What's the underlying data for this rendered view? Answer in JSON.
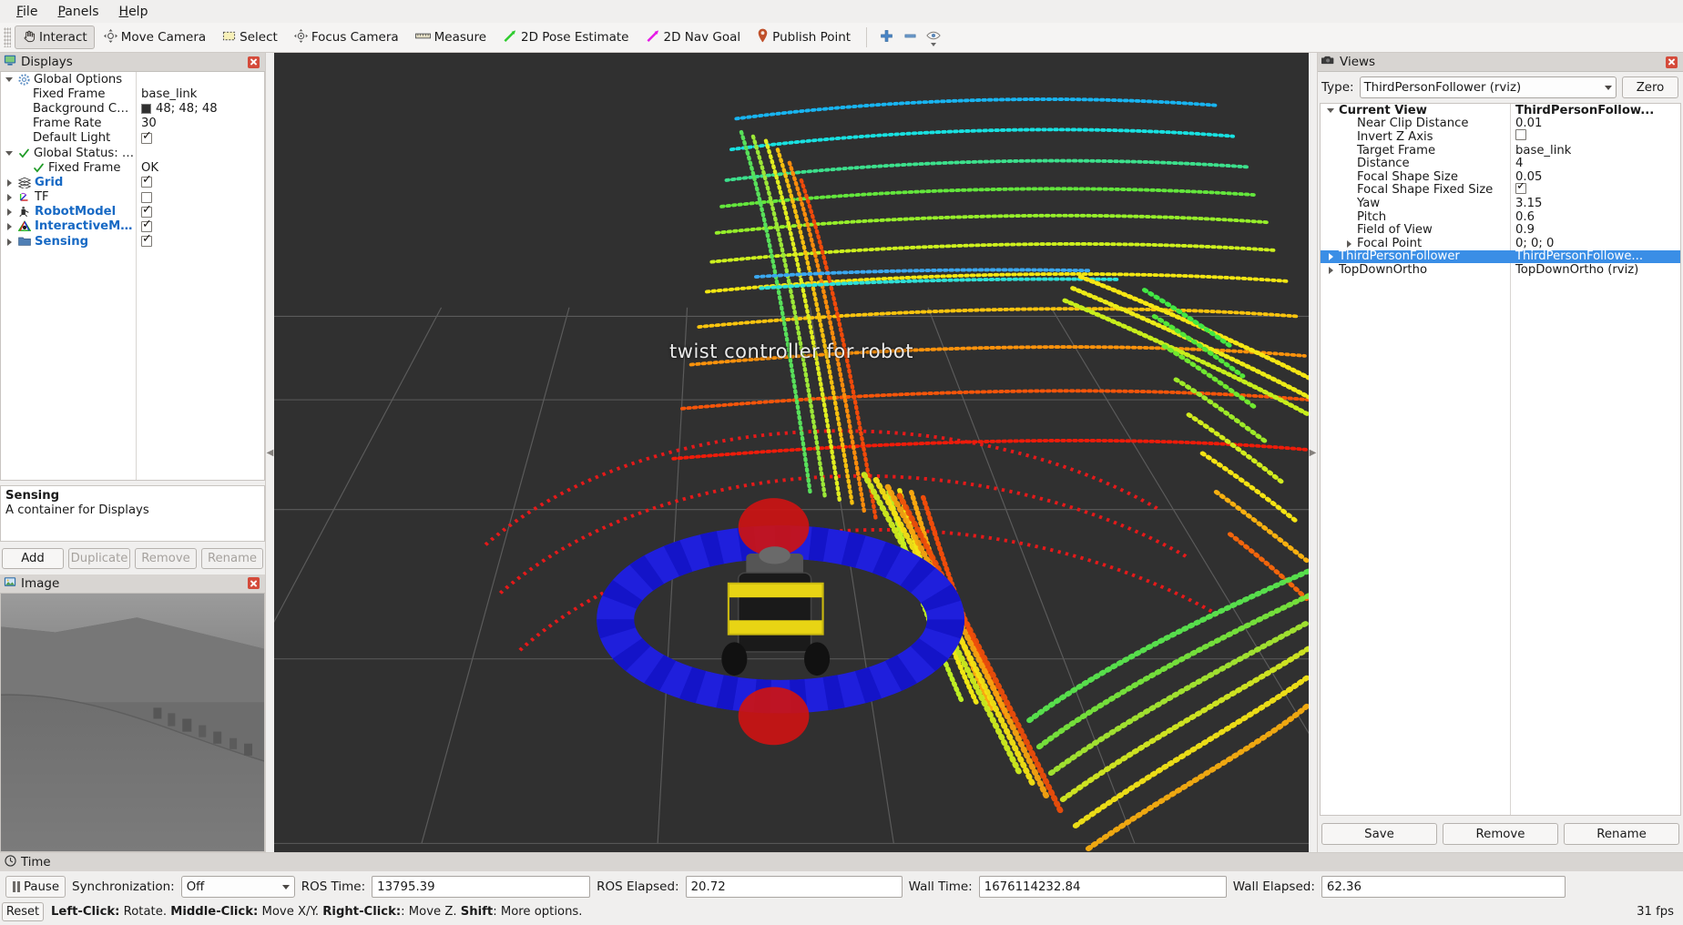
{
  "menu": {
    "items": [
      {
        "name": "file",
        "label": "File",
        "mnemonic": "F"
      },
      {
        "name": "panels",
        "label": "Panels",
        "mnemonic": "P"
      },
      {
        "name": "help",
        "label": "Help",
        "mnemonic": "H"
      }
    ]
  },
  "toolbar": {
    "tools": [
      {
        "name": "interact",
        "label": "Interact",
        "icon": "hand-icon",
        "checked": true
      },
      {
        "name": "move-camera",
        "label": "Move Camera",
        "icon": "move-camera-icon",
        "checked": false
      },
      {
        "name": "select",
        "label": "Select",
        "icon": "select-rect-icon",
        "checked": false
      },
      {
        "name": "focus-camera",
        "label": "Focus Camera",
        "icon": "focus-camera-icon",
        "checked": false
      },
      {
        "name": "measure",
        "label": "Measure",
        "icon": "ruler-icon",
        "checked": false
      },
      {
        "name": "2d-pose-estimate",
        "label": "2D Pose Estimate",
        "icon": "green-arrow-icon",
        "checked": false
      },
      {
        "name": "2d-nav-goal",
        "label": "2D Nav Goal",
        "icon": "magenta-arrow-icon",
        "checked": false
      },
      {
        "name": "publish-point",
        "label": "Publish Point",
        "icon": "map-pin-icon",
        "checked": false
      }
    ],
    "actions": [
      {
        "name": "add-tool",
        "icon": "plus-icon"
      },
      {
        "name": "remove-tool",
        "icon": "minus-icon"
      },
      {
        "name": "tool-properties",
        "icon": "eye-icon"
      }
    ]
  },
  "displays": {
    "title": "Displays",
    "title_icon": "display-monitor-icon",
    "rows": [
      {
        "name": "global-options",
        "indent": 0,
        "arrow": "down",
        "icon": "gear-icon",
        "label": "Global Options",
        "value": "",
        "value_type": "none",
        "bold": false
      },
      {
        "name": "fixed-frame",
        "indent": 1,
        "arrow": "none",
        "icon": "",
        "label": "Fixed Frame",
        "value": "base_link",
        "value_type": "text"
      },
      {
        "name": "background-color",
        "indent": 1,
        "arrow": "none",
        "icon": "",
        "label": "Background Color",
        "value": "48; 48; 48",
        "value_type": "color",
        "color": "#303030"
      },
      {
        "name": "frame-rate",
        "indent": 1,
        "arrow": "none",
        "icon": "",
        "label": "Frame Rate",
        "value": "30",
        "value_type": "text"
      },
      {
        "name": "default-light",
        "indent": 1,
        "arrow": "none",
        "icon": "",
        "label": "Default Light",
        "value": "",
        "value_type": "checkbox",
        "checked": true
      },
      {
        "name": "global-status",
        "indent": 0,
        "arrow": "down",
        "icon": "check-icon",
        "label": "Global Status: Ok",
        "value": "",
        "value_type": "none"
      },
      {
        "name": "status-fixed-frame",
        "indent": 1,
        "arrow": "none",
        "icon": "check-icon",
        "label": "Fixed Frame",
        "value": "OK",
        "value_type": "text"
      },
      {
        "name": "grid",
        "indent": 0,
        "arrow": "right",
        "icon": "grid-icon",
        "label": "Grid",
        "value": "",
        "value_type": "checkbox",
        "checked": true,
        "blue": true
      },
      {
        "name": "tf",
        "indent": 0,
        "arrow": "right",
        "icon": "axes-icon",
        "label": "TF",
        "value": "",
        "value_type": "checkbox",
        "checked": false,
        "blue": false
      },
      {
        "name": "robotmodel",
        "indent": 0,
        "arrow": "right",
        "icon": "robot-icon",
        "label": "RobotModel",
        "value": "",
        "value_type": "checkbox",
        "checked": true,
        "blue": true
      },
      {
        "name": "interactivemarkers",
        "indent": 0,
        "arrow": "right",
        "icon": "interactive-marker-icon",
        "label": "InteractiveMar...",
        "value": "",
        "value_type": "checkbox",
        "checked": true,
        "blue": true
      },
      {
        "name": "sensing",
        "indent": 0,
        "arrow": "right",
        "icon": "folder-icon",
        "label": "Sensing",
        "value": "",
        "value_type": "checkbox",
        "checked": true,
        "blue": true
      }
    ],
    "description": {
      "title": "Sensing",
      "text": "A container for Displays"
    },
    "buttons": [
      {
        "name": "add-display-button",
        "label": "Add",
        "enabled": true
      },
      {
        "name": "duplicate-display-button",
        "label": "Duplicate",
        "enabled": false
      },
      {
        "name": "remove-display-button",
        "label": "Remove",
        "enabled": false
      },
      {
        "name": "rename-display-button",
        "label": "Rename",
        "enabled": false
      }
    ]
  },
  "image_panel": {
    "title": "Image",
    "title_icon": "image-icon"
  },
  "viewport": {
    "overlay_text": "twist  controller  for  robot",
    "background_color": "#303030"
  },
  "views": {
    "title": "Views",
    "title_icon": "camera-icon",
    "type_label": "Type:",
    "type_value": "ThirdPersonFollower (rviz)",
    "zero_button": "Zero",
    "rows": [
      {
        "name": "current-view",
        "indent": 0,
        "arrow": "down",
        "label": "Current View",
        "value": "ThirdPersonFollow...",
        "bold": true,
        "selected": false,
        "value_type": "text"
      },
      {
        "name": "near-clip-distance",
        "indent": 1,
        "arrow": "none",
        "label": "Near Clip Distance",
        "value": "0.01",
        "value_type": "text"
      },
      {
        "name": "invert-z-axis",
        "indent": 1,
        "arrow": "none",
        "label": "Invert Z Axis",
        "value": "",
        "value_type": "checkbox",
        "checked": false
      },
      {
        "name": "target-frame",
        "indent": 1,
        "arrow": "none",
        "label": "Target Frame",
        "value": "base_link",
        "value_type": "text"
      },
      {
        "name": "distance",
        "indent": 1,
        "arrow": "none",
        "label": "Distance",
        "value": "4",
        "value_type": "text"
      },
      {
        "name": "focal-shape-size",
        "indent": 1,
        "arrow": "none",
        "label": "Focal Shape Size",
        "value": "0.05",
        "value_type": "text"
      },
      {
        "name": "focal-shape-fixed-size",
        "indent": 1,
        "arrow": "none",
        "label": "Focal Shape Fixed Size",
        "value": "",
        "value_type": "checkbox",
        "checked": true
      },
      {
        "name": "yaw",
        "indent": 1,
        "arrow": "none",
        "label": "Yaw",
        "value": "3.15",
        "value_type": "text"
      },
      {
        "name": "pitch",
        "indent": 1,
        "arrow": "none",
        "label": "Pitch",
        "value": "0.6",
        "value_type": "text"
      },
      {
        "name": "field-of-view",
        "indent": 1,
        "arrow": "none",
        "label": "Field of View",
        "value": "0.9",
        "value_type": "text"
      },
      {
        "name": "focal-point",
        "indent": 1,
        "arrow": "right",
        "label": "Focal Point",
        "value": "0; 0; 0",
        "value_type": "text"
      },
      {
        "name": "thirdpersonfollower",
        "indent": 0,
        "arrow": "right",
        "label": "ThirdPersonFollower",
        "value": "ThirdPersonFollowe...",
        "value_type": "text",
        "selected": true
      },
      {
        "name": "topdownortho",
        "indent": 0,
        "arrow": "right",
        "label": "TopDownOrtho",
        "value": "TopDownOrtho (rviz)",
        "value_type": "text"
      }
    ],
    "buttons": [
      {
        "name": "save-view-button",
        "label": "Save"
      },
      {
        "name": "remove-view-button",
        "label": "Remove"
      },
      {
        "name": "rename-view-button",
        "label": "Rename"
      }
    ]
  },
  "time": {
    "title": "Time",
    "title_icon": "clock-icon",
    "pause_label": "Pause",
    "sync_label": "Synchronization:",
    "sync_value": "Off",
    "fields": [
      {
        "name": "ros-time",
        "label": "ROS Time:",
        "value": "13795.39"
      },
      {
        "name": "ros-elapsed",
        "label": "ROS Elapsed:",
        "value": "20.72"
      },
      {
        "name": "wall-time",
        "label": "Wall Time:",
        "value": "1676114232.84"
      },
      {
        "name": "wall-elapsed",
        "label": "Wall Elapsed:",
        "value": "62.36"
      }
    ]
  },
  "status": {
    "reset_label": "Reset",
    "hint_parts": [
      {
        "t": "Left-Click:",
        "b": true
      },
      {
        "t": " Rotate. ",
        "b": false
      },
      {
        "t": "Middle-Click:",
        "b": true
      },
      {
        "t": " Move X/Y. ",
        "b": false
      },
      {
        "t": "Right-Click:",
        "b": true
      },
      {
        "t": ": Move Z. ",
        "b": false
      },
      {
        "t": "Shift",
        "b": true
      },
      {
        "t": ": More options.",
        "b": false
      }
    ],
    "fps": "31 fps"
  },
  "colors": {
    "accent_selection": "#3a8ee6",
    "tree_link": "#1769c4",
    "panel_bg": "#f0efee",
    "title_bg": "#d8d5d2",
    "viewport_bg": "#303030",
    "close_red": "#d44a3a"
  }
}
